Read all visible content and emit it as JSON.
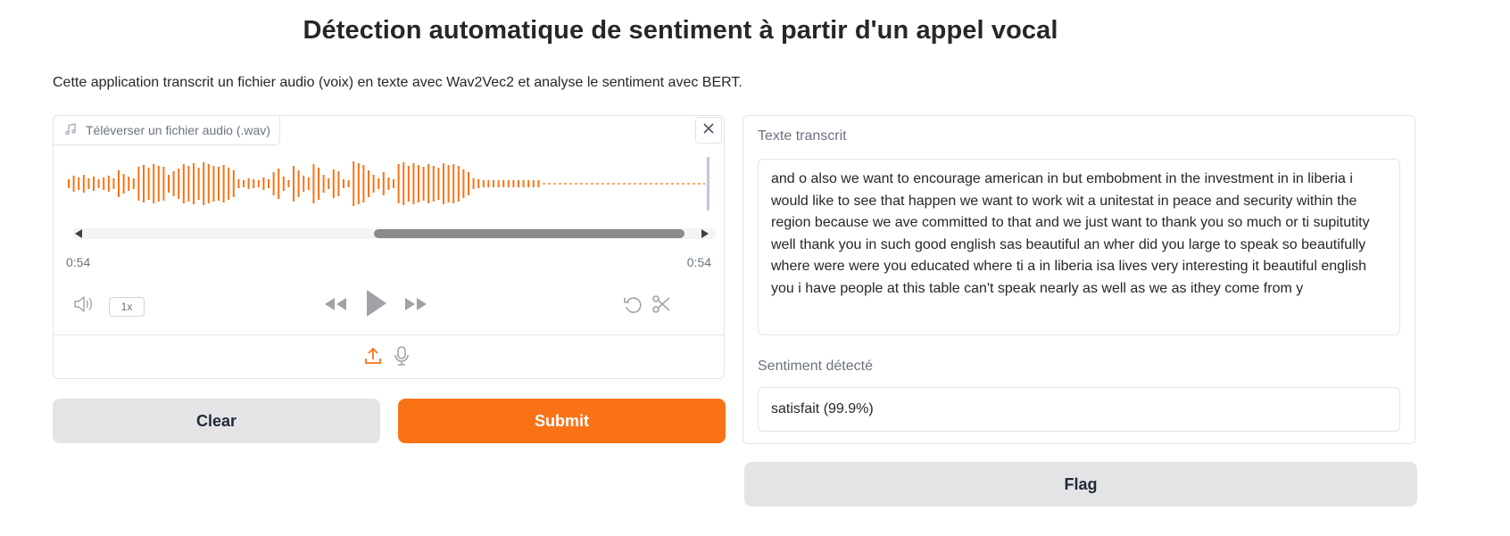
{
  "header": {
    "title": "Détection automatique de sentiment à partir d'un appel vocal",
    "description": "Cette application transcrit un fichier audio (voix) en texte avec Wav2Vec2 et analyse le sentiment avec BERT."
  },
  "audio_input": {
    "label": "Téléverser un fichier audio (.wav)",
    "label_icon": "music-note-icon",
    "time_current": "0:54",
    "time_total": "0:54",
    "playback_speed": "1x",
    "accent_color": "#f97316",
    "icons": [
      "volume-icon",
      "rewind-icon",
      "play-icon",
      "fast-forward-icon",
      "undo-icon",
      "scissors-icon",
      "upload-icon",
      "microphone-icon",
      "close-icon"
    ]
  },
  "buttons": {
    "clear": "Clear",
    "submit": "Submit",
    "flag": "Flag"
  },
  "output": {
    "transcript_label": "Texte transcrit",
    "transcript_text": "and o also we want to encourage american in but embobment in the investment in in liberia i would like to see that happen we want to work wit a unitestat in peace and security within the region because we ave committed to that and we just want to thank you so much or ti supitutity well thank you in such good english sas beautiful  an wher did you large to speak so beautifully where were were you educated where ti a in liberia isa lives very interesting it beautiful english you i have people at this table can't speak nearly as well as we as ithey come from y",
    "sentiment_label": "Sentiment détecté",
    "sentiment_value": "satisfait (99.9%)"
  }
}
